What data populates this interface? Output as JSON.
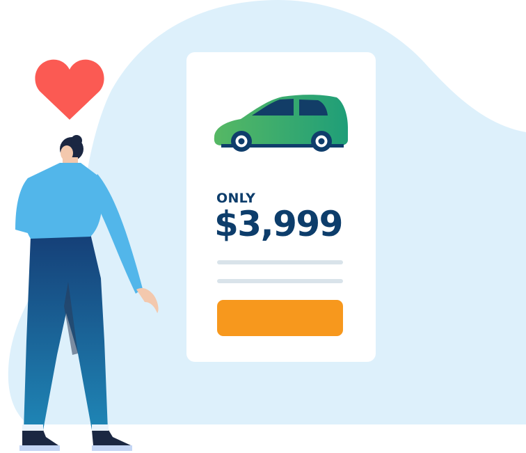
{
  "card": {
    "label": "ONLY",
    "price": "$3,999"
  },
  "colors": {
    "blob": "#ddf0fb",
    "price_text": "#0d3d6b",
    "button": "#f7981d",
    "car_body": "#55b862",
    "heart": "#fb5a53",
    "shirt": "#52b6ea",
    "overalls": "#16508a"
  },
  "icons": {
    "heart": "heart-icon",
    "car": "car-icon"
  }
}
